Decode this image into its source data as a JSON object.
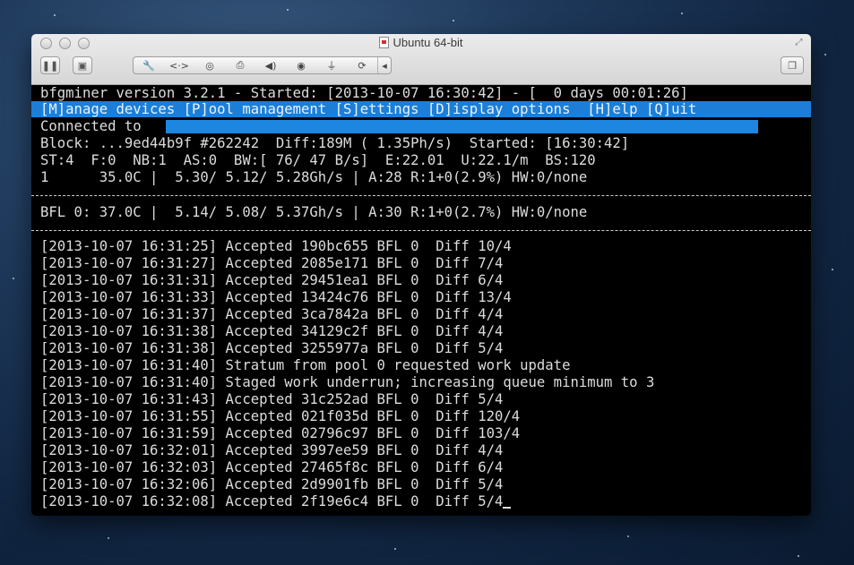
{
  "window": {
    "title": "Ubuntu 64-bit"
  },
  "toolbar": {
    "icons": [
      "pause-icon",
      "vm-settings-icon",
      "wrench-icon",
      "network-icon",
      "disk-icon",
      "printer-icon",
      "sound-icon",
      "camera-icon",
      "usb-icon",
      "share-icon",
      "arrow-left-icon",
      "restore-icon"
    ]
  },
  "terminal": {
    "header": "bfgminer version 3.2.1 - Started: [2013-10-07 16:30:42] - [  0 days 00:01:26]",
    "menu": "[M]anage devices [P]ool management [S]ettings [D]isplay options  [H]elp [Q]uit",
    "connected": "Connected to",
    "block": "Block: ...9ed44b9f #262242  Diff:189M ( 1.35Ph/s)  Started: [16:30:42]",
    "stats": "ST:4  F:0  NB:1  AS:0  BW:[ 76/ 47 B/s]  E:22.01  U:22.1/m  BS:120",
    "device_summary": "1      35.0C |  5.30/ 5.12/ 5.28Gh/s | A:28 R:1+0(2.9%) HW:0/none",
    "device": "BFL 0: 37.0C |  5.14/ 5.08/ 5.37Gh/s | A:30 R:1+0(2.7%) HW:0/none",
    "log": [
      "[2013-10-07 16:31:25] Accepted 190bc655 BFL 0  Diff 10/4",
      "[2013-10-07 16:31:27] Accepted 2085e171 BFL 0  Diff 7/4",
      "[2013-10-07 16:31:31] Accepted 29451ea1 BFL 0  Diff 6/4",
      "[2013-10-07 16:31:33] Accepted 13424c76 BFL 0  Diff 13/4",
      "[2013-10-07 16:31:37] Accepted 3ca7842a BFL 0  Diff 4/4",
      "[2013-10-07 16:31:38] Accepted 34129c2f BFL 0  Diff 4/4",
      "[2013-10-07 16:31:38] Accepted 3255977a BFL 0  Diff 5/4",
      "[2013-10-07 16:31:40] Stratum from pool 0 requested work update",
      "[2013-10-07 16:31:40] Staged work underrun; increasing queue minimum to 3",
      "[2013-10-07 16:31:43] Accepted 31c252ad BFL 0  Diff 5/4",
      "[2013-10-07 16:31:55] Accepted 021f035d BFL 0  Diff 120/4",
      "[2013-10-07 16:31:59] Accepted 02796c97 BFL 0  Diff 103/4",
      "[2013-10-07 16:32:01] Accepted 3997ee59 BFL 0  Diff 4/4",
      "[2013-10-07 16:32:03] Accepted 27465f8c BFL 0  Diff 6/4",
      "[2013-10-07 16:32:06] Accepted 2d9901fb BFL 0  Diff 5/4",
      "[2013-10-07 16:32:08] Accepted 2f19e6c4 BFL 0  Diff 5/4"
    ]
  },
  "colors": {
    "menu_bar": "#1c7ed6",
    "progress": "#1c86e0",
    "terminal_bg": "#000000",
    "terminal_fg": "#dcdcdc"
  }
}
